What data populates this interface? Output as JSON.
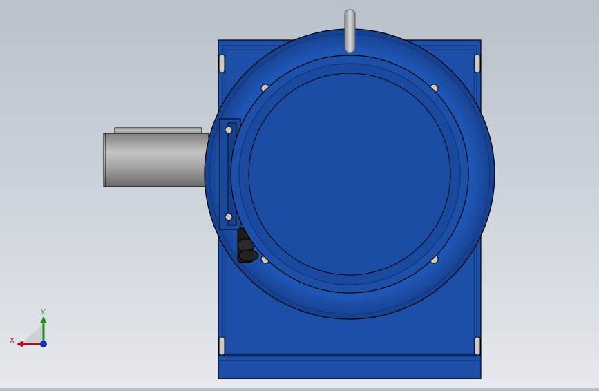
{
  "viewport": {
    "background_top": "#b9c1cb",
    "background_bottom": "#e6e9ed"
  },
  "model": {
    "housing_color": "#1d4fa8",
    "housing_dark": "#0f2f6e",
    "shaft_color": "#9a9a9a",
    "outline_color": "#000000"
  },
  "triad": {
    "x_label": "X",
    "y_label": "Y",
    "x_color": "#b01010",
    "y_color": "#1a8f1a",
    "z_color": "#1030c0"
  }
}
